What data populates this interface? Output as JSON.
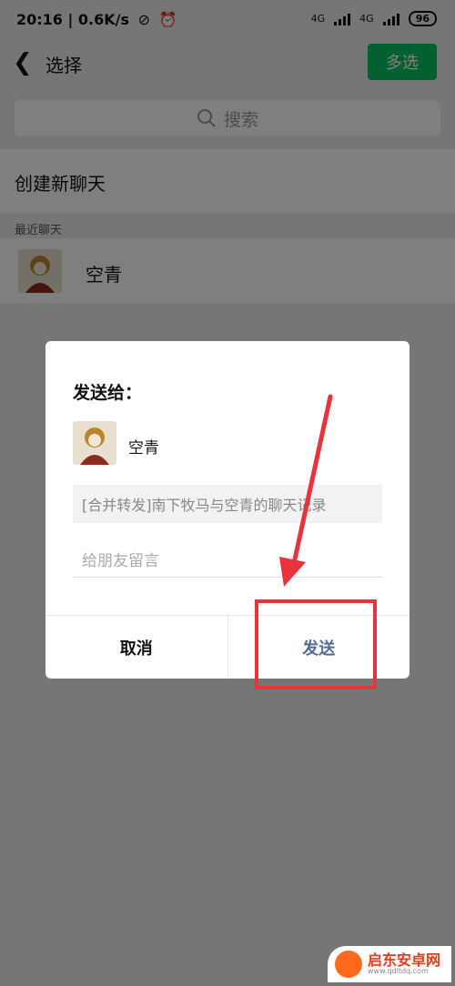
{
  "status": {
    "time_speed": "20:16 | 0.6K/s",
    "icons": [
      "no-disturb-icon",
      "alarm-icon"
    ],
    "net1": "4G",
    "net2": "4G",
    "battery": "96"
  },
  "nav": {
    "title": "选择",
    "multi_select": "多选"
  },
  "search": {
    "placeholder": "搜索"
  },
  "create_chat": "创建新聊天",
  "recent_label": "最近聊天",
  "recent": [
    {
      "name": "空青"
    }
  ],
  "dialog": {
    "title": "发送给：",
    "recipient": "空青",
    "message": "[合并转发]南下牧马与空青的聊天记录",
    "comment_placeholder": "给朋友留言",
    "cancel": "取消",
    "send": "发送"
  },
  "annotation": {
    "color": "#e8323c"
  },
  "watermark": {
    "name": "启东安卓网",
    "url": "www.qdltdq.com"
  },
  "colors": {
    "accent": "#07c160",
    "link": "#576b95"
  }
}
